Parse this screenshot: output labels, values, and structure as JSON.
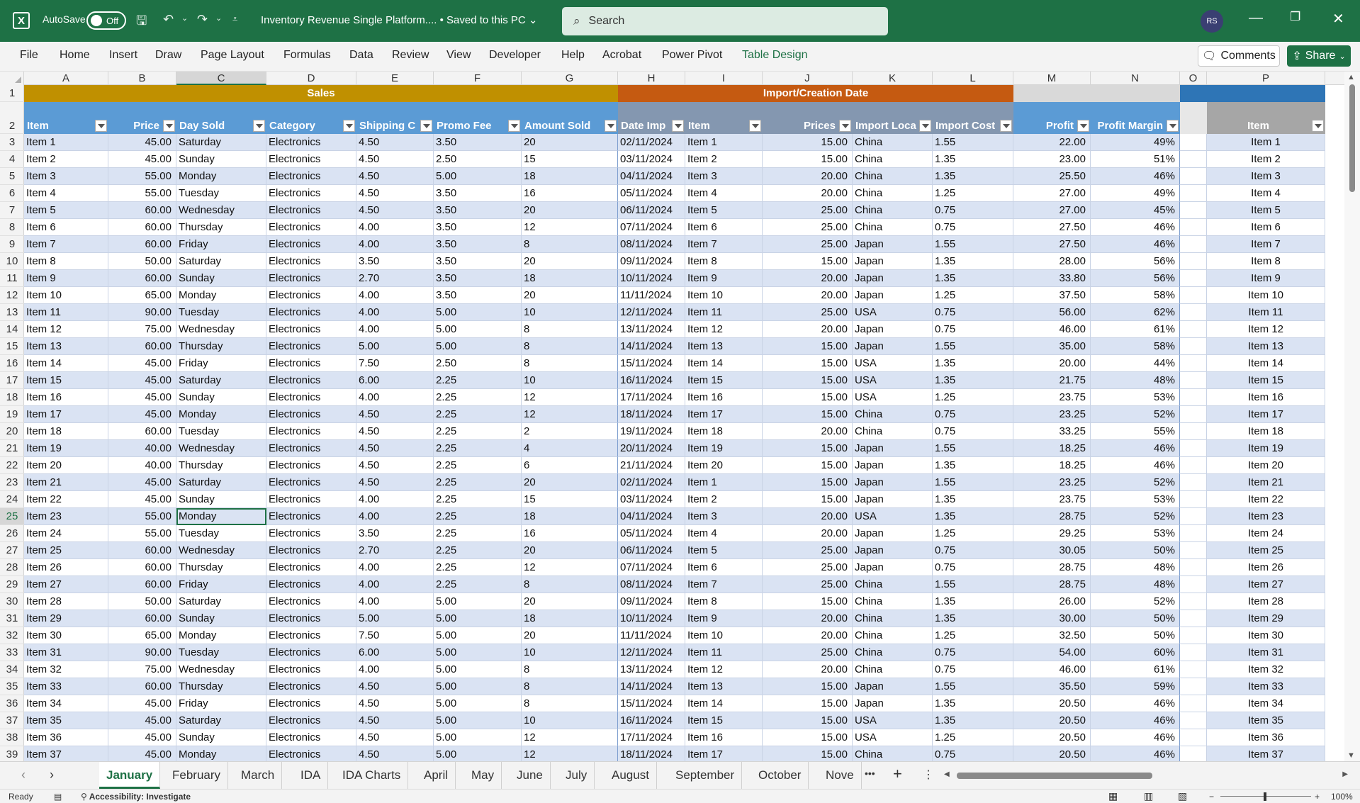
{
  "titlebar": {
    "autosave_label": "AutoSave",
    "autosave_state": "Off",
    "doc_title": "Inventory Revenue Single Platform.... • Saved to this PC ⌄",
    "search_placeholder": "Search",
    "avatar_initials": "RS",
    "app_icon_letter": "X"
  },
  "ribbon": {
    "tabs": [
      "File",
      "Home",
      "Insert",
      "Draw",
      "Page Layout",
      "Formulas",
      "Data",
      "Review",
      "View",
      "Developer",
      "Help",
      "Acrobat",
      "Power Pivot",
      "Table Design"
    ],
    "active_tab": "Table Design",
    "comments_label": "Comments",
    "share_label": "Share"
  },
  "sheet": {
    "columns": [
      "A",
      "B",
      "C",
      "D",
      "E",
      "F",
      "G",
      "H",
      "I",
      "J",
      "K",
      "L",
      "M",
      "N",
      "O",
      "P"
    ],
    "selected_column": "C",
    "selected_row": 25,
    "band_sales": "Sales",
    "band_import": "Import/Creation Date",
    "headers": [
      "Item",
      "Price",
      "Day Sold",
      "Category",
      "Shipping C",
      "Promo Fee",
      "Amount Sold",
      "Date Imp",
      "Item",
      "Prices",
      "Import Loca",
      "Import Cost",
      "Profit",
      "Profit Margin",
      "",
      "Item"
    ],
    "colors": {
      "sales_band": "#c09000",
      "import_band": "#c55a11",
      "header_blue": "#5b9bd5",
      "header_grey": "#8497b0",
      "row_band": "#dae3f3",
      "p_header": "#a6a6a6",
      "o_band": "#2e75b6"
    },
    "rows": [
      [
        "Item 1",
        "45.00",
        "Saturday",
        "Electronics",
        "4.50",
        "3.50",
        "20",
        "02/11/2024",
        "Item 1",
        "15.00",
        "China",
        "1.55",
        "22.00",
        "49%",
        "",
        "Item 1"
      ],
      [
        "Item 2",
        "45.00",
        "Sunday",
        "Electronics",
        "4.50",
        "2.50",
        "15",
        "03/11/2024",
        "Item 2",
        "15.00",
        "China",
        "1.35",
        "23.00",
        "51%",
        "",
        "Item 2"
      ],
      [
        "Item 3",
        "55.00",
        "Monday",
        "Electronics",
        "4.50",
        "5.00",
        "18",
        "04/11/2024",
        "Item 3",
        "20.00",
        "China",
        "1.35",
        "25.50",
        "46%",
        "",
        "Item 3"
      ],
      [
        "Item 4",
        "55.00",
        "Tuesday",
        "Electronics",
        "4.50",
        "3.50",
        "16",
        "05/11/2024",
        "Item 4",
        "20.00",
        "China",
        "1.25",
        "27.00",
        "49%",
        "",
        "Item 4"
      ],
      [
        "Item 5",
        "60.00",
        "Wednesday",
        "Electronics",
        "4.50",
        "3.50",
        "20",
        "06/11/2024",
        "Item 5",
        "25.00",
        "China",
        "0.75",
        "27.00",
        "45%",
        "",
        "Item 5"
      ],
      [
        "Item 6",
        "60.00",
        "Thursday",
        "Electronics",
        "4.00",
        "3.50",
        "12",
        "07/11/2024",
        "Item 6",
        "25.00",
        "China",
        "0.75",
        "27.50",
        "46%",
        "",
        "Item 6"
      ],
      [
        "Item 7",
        "60.00",
        "Friday",
        "Electronics",
        "4.00",
        "3.50",
        "8",
        "08/11/2024",
        "Item 7",
        "25.00",
        "Japan",
        "1.55",
        "27.50",
        "46%",
        "",
        "Item 7"
      ],
      [
        "Item 8",
        "50.00",
        "Saturday",
        "Electronics",
        "3.50",
        "3.50",
        "20",
        "09/11/2024",
        "Item 8",
        "15.00",
        "Japan",
        "1.35",
        "28.00",
        "56%",
        "",
        "Item 8"
      ],
      [
        "Item 9",
        "60.00",
        "Sunday",
        "Electronics",
        "2.70",
        "3.50",
        "18",
        "10/11/2024",
        "Item 9",
        "20.00",
        "Japan",
        "1.35",
        "33.80",
        "56%",
        "",
        "Item 9"
      ],
      [
        "Item 10",
        "65.00",
        "Monday",
        "Electronics",
        "4.00",
        "3.50",
        "20",
        "11/11/2024",
        "Item 10",
        "20.00",
        "Japan",
        "1.25",
        "37.50",
        "58%",
        "",
        "Item 10"
      ],
      [
        "Item 11",
        "90.00",
        "Tuesday",
        "Electronics",
        "4.00",
        "5.00",
        "10",
        "12/11/2024",
        "Item 11",
        "25.00",
        "USA",
        "0.75",
        "56.00",
        "62%",
        "",
        "Item 11"
      ],
      [
        "Item 12",
        "75.00",
        "Wednesday",
        "Electronics",
        "4.00",
        "5.00",
        "8",
        "13/11/2024",
        "Item 12",
        "20.00",
        "Japan",
        "0.75",
        "46.00",
        "61%",
        "",
        "Item 12"
      ],
      [
        "Item 13",
        "60.00",
        "Thursday",
        "Electronics",
        "5.00",
        "5.00",
        "8",
        "14/11/2024",
        "Item 13",
        "15.00",
        "Japan",
        "1.55",
        "35.00",
        "58%",
        "",
        "Item 13"
      ],
      [
        "Item 14",
        "45.00",
        "Friday",
        "Electronics",
        "7.50",
        "2.50",
        "8",
        "15/11/2024",
        "Item 14",
        "15.00",
        "USA",
        "1.35",
        "20.00",
        "44%",
        "",
        "Item 14"
      ],
      [
        "Item 15",
        "45.00",
        "Saturday",
        "Electronics",
        "6.00",
        "2.25",
        "10",
        "16/11/2024",
        "Item 15",
        "15.00",
        "USA",
        "1.35",
        "21.75",
        "48%",
        "",
        "Item 15"
      ],
      [
        "Item 16",
        "45.00",
        "Sunday",
        "Electronics",
        "4.00",
        "2.25",
        "12",
        "17/11/2024",
        "Item 16",
        "15.00",
        "USA",
        "1.25",
        "23.75",
        "53%",
        "",
        "Item 16"
      ],
      [
        "Item 17",
        "45.00",
        "Monday",
        "Electronics",
        "4.50",
        "2.25",
        "12",
        "18/11/2024",
        "Item 17",
        "15.00",
        "China",
        "0.75",
        "23.25",
        "52%",
        "",
        "Item 17"
      ],
      [
        "Item 18",
        "60.00",
        "Tuesday",
        "Electronics",
        "4.50",
        "2.25",
        "2",
        "19/11/2024",
        "Item 18",
        "20.00",
        "China",
        "0.75",
        "33.25",
        "55%",
        "",
        "Item 18"
      ],
      [
        "Item 19",
        "40.00",
        "Wednesday",
        "Electronics",
        "4.50",
        "2.25",
        "4",
        "20/11/2024",
        "Item 19",
        "15.00",
        "Japan",
        "1.55",
        "18.25",
        "46%",
        "",
        "Item 19"
      ],
      [
        "Item 20",
        "40.00",
        "Thursday",
        "Electronics",
        "4.50",
        "2.25",
        "6",
        "21/11/2024",
        "Item 20",
        "15.00",
        "Japan",
        "1.35",
        "18.25",
        "46%",
        "",
        "Item 20"
      ],
      [
        "Item 21",
        "45.00",
        "Saturday",
        "Electronics",
        "4.50",
        "2.25",
        "20",
        "02/11/2024",
        "Item 1",
        "15.00",
        "Japan",
        "1.55",
        "23.25",
        "52%",
        "",
        "Item 21"
      ],
      [
        "Item 22",
        "45.00",
        "Sunday",
        "Electronics",
        "4.00",
        "2.25",
        "15",
        "03/11/2024",
        "Item 2",
        "15.00",
        "Japan",
        "1.35",
        "23.75",
        "53%",
        "",
        "Item 22"
      ],
      [
        "Item 23",
        "55.00",
        "Monday",
        "Electronics",
        "4.00",
        "2.25",
        "18",
        "04/11/2024",
        "Item 3",
        "20.00",
        "USA",
        "1.35",
        "28.75",
        "52%",
        "",
        "Item 23"
      ],
      [
        "Item 24",
        "55.00",
        "Tuesday",
        "Electronics",
        "3.50",
        "2.25",
        "16",
        "05/11/2024",
        "Item 4",
        "20.00",
        "Japan",
        "1.25",
        "29.25",
        "53%",
        "",
        "Item 24"
      ],
      [
        "Item 25",
        "60.00",
        "Wednesday",
        "Electronics",
        "2.70",
        "2.25",
        "20",
        "06/11/2024",
        "Item 5",
        "25.00",
        "Japan",
        "0.75",
        "30.05",
        "50%",
        "",
        "Item 25"
      ],
      [
        "Item 26",
        "60.00",
        "Thursday",
        "Electronics",
        "4.00",
        "2.25",
        "12",
        "07/11/2024",
        "Item 6",
        "25.00",
        "Japan",
        "0.75",
        "28.75",
        "48%",
        "",
        "Item 26"
      ],
      [
        "Item 27",
        "60.00",
        "Friday",
        "Electronics",
        "4.00",
        "2.25",
        "8",
        "08/11/2024",
        "Item 7",
        "25.00",
        "China",
        "1.55",
        "28.75",
        "48%",
        "",
        "Item 27"
      ],
      [
        "Item 28",
        "50.00",
        "Saturday",
        "Electronics",
        "4.00",
        "5.00",
        "20",
        "09/11/2024",
        "Item 8",
        "15.00",
        "China",
        "1.35",
        "26.00",
        "52%",
        "",
        "Item 28"
      ],
      [
        "Item 29",
        "60.00",
        "Sunday",
        "Electronics",
        "5.00",
        "5.00",
        "18",
        "10/11/2024",
        "Item 9",
        "20.00",
        "China",
        "1.35",
        "30.00",
        "50%",
        "",
        "Item 29"
      ],
      [
        "Item 30",
        "65.00",
        "Monday",
        "Electronics",
        "7.50",
        "5.00",
        "20",
        "11/11/2024",
        "Item 10",
        "20.00",
        "China",
        "1.25",
        "32.50",
        "50%",
        "",
        "Item 30"
      ],
      [
        "Item 31",
        "90.00",
        "Tuesday",
        "Electronics",
        "6.00",
        "5.00",
        "10",
        "12/11/2024",
        "Item 11",
        "25.00",
        "China",
        "0.75",
        "54.00",
        "60%",
        "",
        "Item 31"
      ],
      [
        "Item 32",
        "75.00",
        "Wednesday",
        "Electronics",
        "4.00",
        "5.00",
        "8",
        "13/11/2024",
        "Item 12",
        "20.00",
        "China",
        "0.75",
        "46.00",
        "61%",
        "",
        "Item 32"
      ],
      [
        "Item 33",
        "60.00",
        "Thursday",
        "Electronics",
        "4.50",
        "5.00",
        "8",
        "14/11/2024",
        "Item 13",
        "15.00",
        "Japan",
        "1.55",
        "35.50",
        "59%",
        "",
        "Item 33"
      ],
      [
        "Item 34",
        "45.00",
        "Friday",
        "Electronics",
        "4.50",
        "5.00",
        "8",
        "15/11/2024",
        "Item 14",
        "15.00",
        "Japan",
        "1.35",
        "20.50",
        "46%",
        "",
        "Item 34"
      ],
      [
        "Item 35",
        "45.00",
        "Saturday",
        "Electronics",
        "4.50",
        "5.00",
        "10",
        "16/11/2024",
        "Item 15",
        "15.00",
        "USA",
        "1.35",
        "20.50",
        "46%",
        "",
        "Item 35"
      ],
      [
        "Item 36",
        "45.00",
        "Sunday",
        "Electronics",
        "4.50",
        "5.00",
        "12",
        "17/11/2024",
        "Item 16",
        "15.00",
        "USA",
        "1.25",
        "20.50",
        "46%",
        "",
        "Item 36"
      ],
      [
        "Item 37",
        "45.00",
        "Monday",
        "Electronics",
        "4.50",
        "5.00",
        "12",
        "18/11/2024",
        "Item 17",
        "15.00",
        "China",
        "0.75",
        "20.50",
        "46%",
        "",
        "Item 37"
      ]
    ]
  },
  "sheet_tabs": {
    "tabs": [
      "January",
      "February",
      "March",
      "IDA",
      "IDA Charts",
      "April",
      "May",
      "June",
      "July",
      "August",
      "September",
      "October",
      "Nove"
    ],
    "active": "January",
    "more_label": "•••",
    "add_label": "+"
  },
  "statusbar": {
    "ready": "Ready",
    "accessibility": "Accessibility: Investigate",
    "zoom": "100%"
  }
}
